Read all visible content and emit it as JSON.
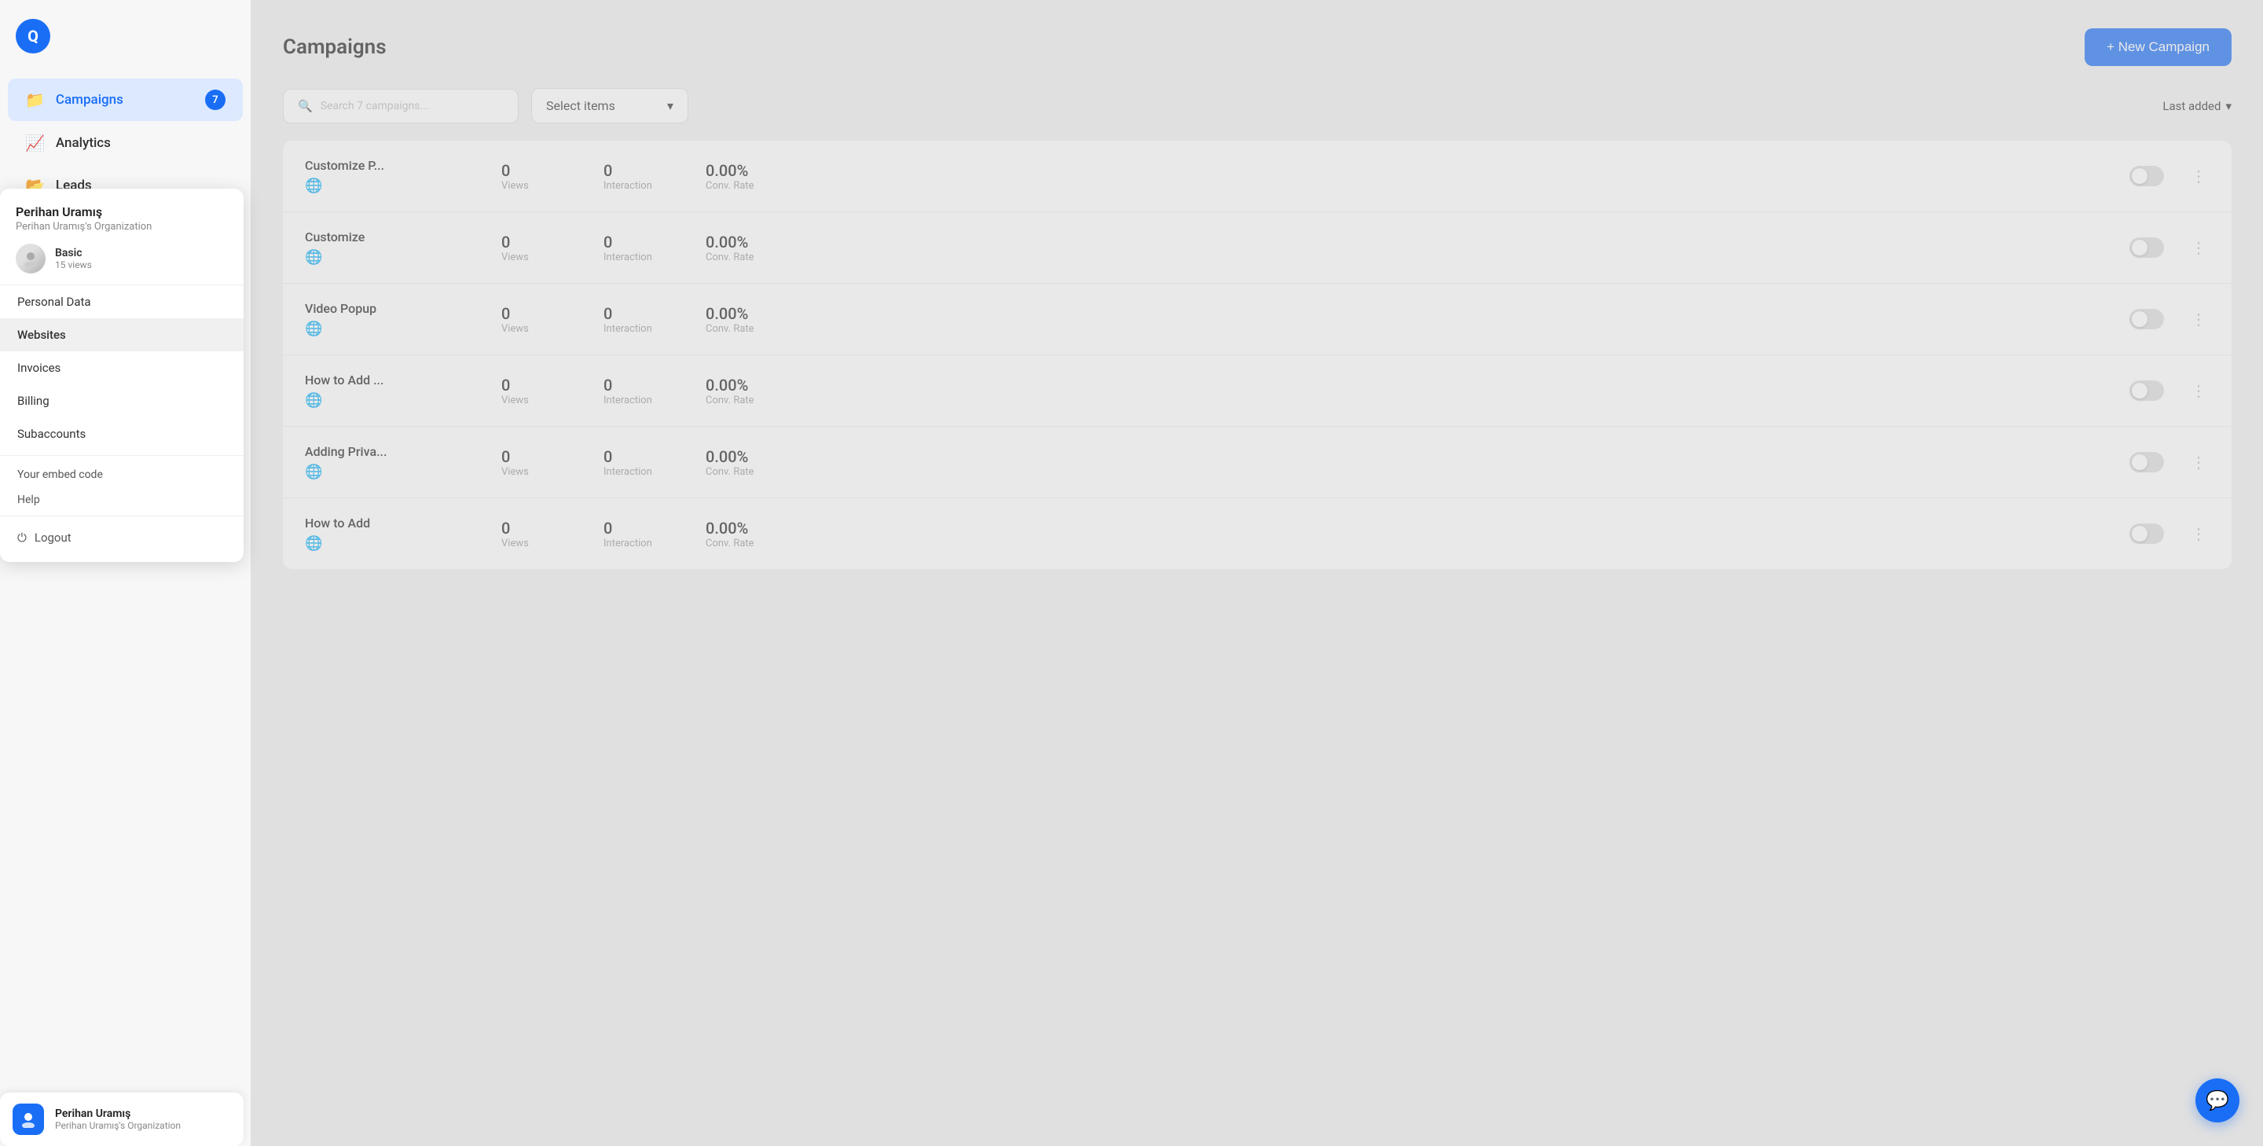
{
  "app": {
    "logo_text": "Q"
  },
  "sidebar": {
    "nav_items": [
      {
        "id": "campaigns",
        "label": "Campaigns",
        "icon": "📁",
        "badge": "7",
        "active": true
      },
      {
        "id": "analytics",
        "label": "Analytics",
        "icon": "📈",
        "badge": null,
        "active": false
      },
      {
        "id": "leads",
        "label": "Leads",
        "icon": "📂",
        "badge": null,
        "active": false
      }
    ]
  },
  "user_dropdown": {
    "name": "Perihan Uramış",
    "org": "Perihan Uramış's Organization",
    "plan_name": "Basic",
    "plan_views": "15 views",
    "menu_items": [
      {
        "id": "personal-data",
        "label": "Personal Data"
      },
      {
        "id": "websites",
        "label": "Websites",
        "active": true
      },
      {
        "id": "invoices",
        "label": "Invoices"
      },
      {
        "id": "billing",
        "label": "Billing"
      },
      {
        "id": "subaccounts",
        "label": "Subaccounts"
      }
    ],
    "embed_label": "Your embed code",
    "help_label": "Help",
    "logout_label": "Logout"
  },
  "user_bar": {
    "name": "Perihan Uramış",
    "org": "Perihan Uramış's Organization"
  },
  "main": {
    "title": "Campaigns",
    "new_campaign_label": "+ New Campaign",
    "search_placeholder": "Search 7 campaigns...",
    "select_items_label": "Select items",
    "sort_label": "Last added",
    "campaigns": [
      {
        "id": 1,
        "name": "Customize P...",
        "views": "0",
        "interaction": "0",
        "conv_rate": "0.00%",
        "enabled": false
      },
      {
        "id": 2,
        "name": "Customize",
        "views": "0",
        "interaction": "0",
        "conv_rate": "0.00%",
        "enabled": false
      },
      {
        "id": 3,
        "name": "Video Popup",
        "views": "0",
        "interaction": "0",
        "conv_rate": "0.00%",
        "enabled": false
      },
      {
        "id": 4,
        "name": "How to Add ...",
        "views": "0",
        "interaction": "0",
        "conv_rate": "0.00%",
        "enabled": false
      },
      {
        "id": 5,
        "name": "Adding Priva...",
        "views": "0",
        "interaction": "0",
        "conv_rate": "0.00%",
        "enabled": false
      },
      {
        "id": 6,
        "name": "How to Add",
        "views": "0",
        "interaction": "0",
        "conv_rate": "0.00%",
        "enabled": false
      }
    ],
    "stat_labels": {
      "views": "Views",
      "interaction": "Interaction",
      "conv_rate": "Conv. Rate"
    }
  }
}
